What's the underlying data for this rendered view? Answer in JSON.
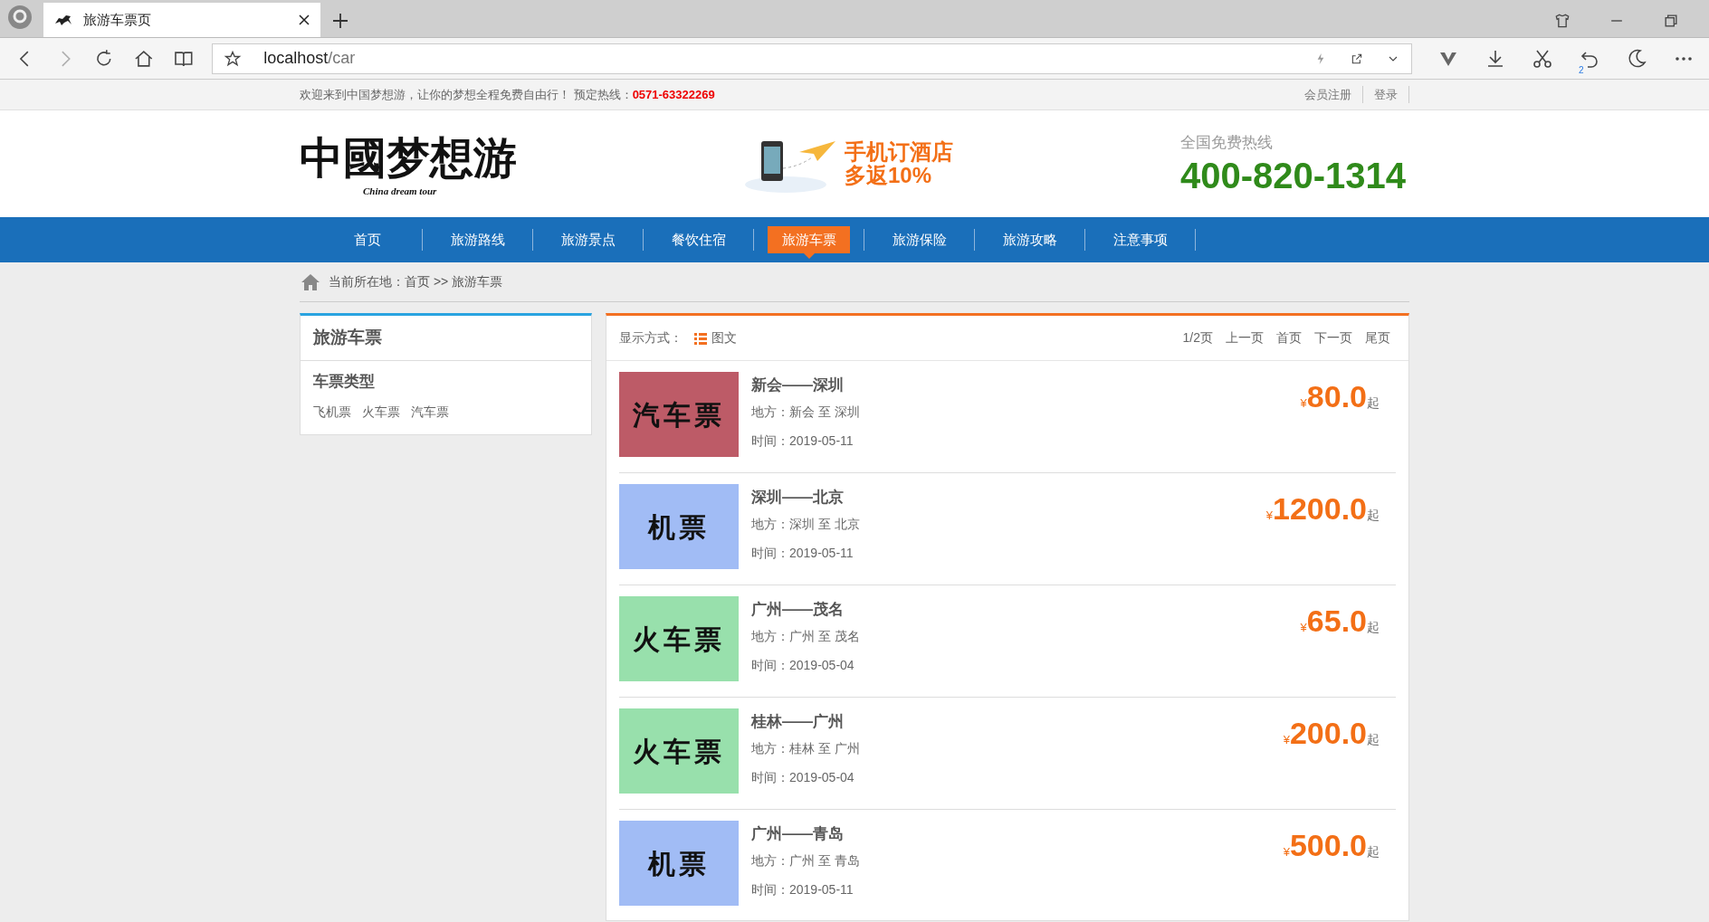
{
  "browser": {
    "tab_title": "旅游车票页",
    "address_host": "localhost",
    "address_path": "/car",
    "badge": "2"
  },
  "topbar": {
    "welcome": "欢迎来到中国梦想游，让你的梦想全程免费自由行！ 预定热线：",
    "phone": "0571-63322269",
    "links": [
      "会员注册",
      "登录"
    ]
  },
  "header": {
    "logo": "中國梦想游",
    "logo_sub": "China dream tour",
    "promo_line1": "手机订酒店",
    "promo_line2": "多返10%",
    "hotline_label": "全国免费热线",
    "hotline": "400-820-1314"
  },
  "nav": [
    {
      "label": "首页",
      "selected": false
    },
    {
      "label": "旅游路线",
      "selected": false
    },
    {
      "label": "旅游景点",
      "selected": false
    },
    {
      "label": "餐饮住宿",
      "selected": false
    },
    {
      "label": "旅游车票",
      "selected": true
    },
    {
      "label": "旅游保险",
      "selected": false
    },
    {
      "label": "旅游攻略",
      "selected": false
    },
    {
      "label": "注意事项",
      "selected": false
    }
  ],
  "breadcrumb": {
    "label": "当前所在地：",
    "path": "首页 >> 旅游车票"
  },
  "sidebar": {
    "title": "旅游车票",
    "section": "车票类型",
    "links": [
      "飞机票",
      "火车票",
      "汽车票"
    ]
  },
  "list_toolbar": {
    "display_label": "显示方式：",
    "view": "图文",
    "pager": [
      "1/2页",
      "上一页",
      "首页",
      "下一页",
      "尾页"
    ]
  },
  "tickets": [
    {
      "image_text": "汽车票",
      "color": "#bd5b67",
      "title": "新会——深圳",
      "place": "地方：新会 至 深圳",
      "time": "时间：2019-05-11",
      "currency": "¥",
      "price": "80.0",
      "suffix": "起"
    },
    {
      "image_text": "机票",
      "color": "#a1bcf5",
      "title": "深圳——北京",
      "place": "地方：深圳 至 北京",
      "time": "时间：2019-05-11",
      "currency": "¥",
      "price": "1200.0",
      "suffix": "起"
    },
    {
      "image_text": "火车票",
      "color": "#98e0ac",
      "title": "广州——茂名",
      "place": "地方：广州 至 茂名",
      "time": "时间：2019-05-04",
      "currency": "¥",
      "price": "65.0",
      "suffix": "起"
    },
    {
      "image_text": "火车票",
      "color": "#98e0ac",
      "title": "桂林——广州",
      "place": "地方：桂林 至 广州",
      "time": "时间：2019-05-04",
      "currency": "¥",
      "price": "200.0",
      "suffix": "起"
    },
    {
      "image_text": "机票",
      "color": "#a1bcf5",
      "title": "广州——青岛",
      "place": "地方：广州 至 青岛",
      "time": "时间：2019-05-11",
      "currency": "¥",
      "price": "500.0",
      "suffix": "起"
    }
  ]
}
